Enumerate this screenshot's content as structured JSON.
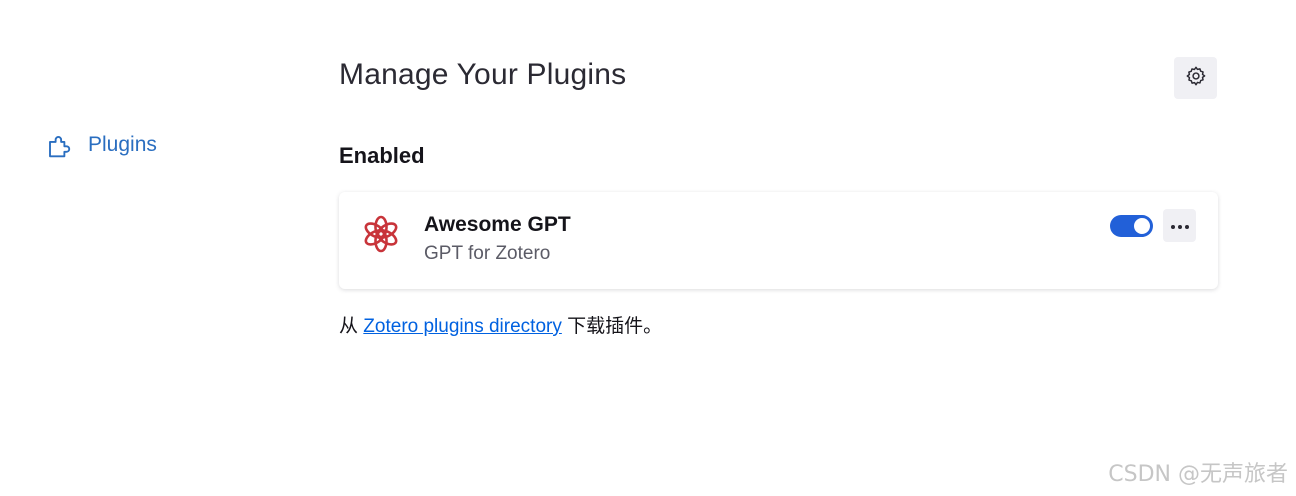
{
  "sidebar": {
    "items": [
      {
        "label": "Plugins",
        "icon": "puzzle-piece-icon",
        "selected": true
      }
    ]
  },
  "main": {
    "title": "Manage Your Plugins",
    "settings_icon": "gear-icon",
    "section_heading": "Enabled",
    "plugins": [
      {
        "name": "Awesome GPT",
        "description": "GPT for Zotero",
        "icon": "openai-logo-icon",
        "enabled": true,
        "more_icon": "ellipsis-icon"
      }
    ],
    "footer": {
      "prefix": "从",
      "link_text": "Zotero plugins directory",
      "suffix": "下载插件。"
    }
  },
  "watermark": "CSDN @无声旅者",
  "colors": {
    "accent": "#2260d8",
    "sidebar_selected": "#2a6ec0",
    "link": "#0061e0",
    "logo_red": "#c8343a"
  }
}
